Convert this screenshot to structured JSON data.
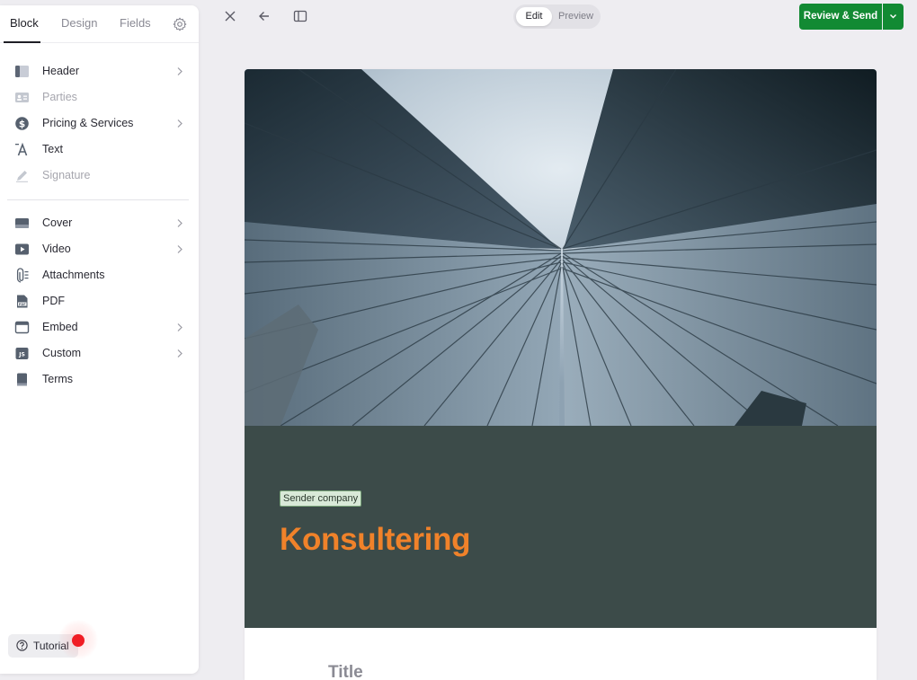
{
  "panel": {
    "tabs": [
      {
        "label": "Block"
      },
      {
        "label": "Design"
      },
      {
        "label": "Fields"
      }
    ],
    "group1": [
      {
        "label": "Header",
        "icon": "header-block-icon",
        "chevron": true,
        "enabled": true
      },
      {
        "label": "Parties",
        "icon": "parties-icon",
        "chevron": false,
        "enabled": false
      },
      {
        "label": "Pricing & Services",
        "icon": "dollar-icon",
        "chevron": true,
        "enabled": true
      },
      {
        "label": "Text",
        "icon": "text-icon",
        "chevron": false,
        "enabled": true
      },
      {
        "label": "Signature",
        "icon": "pen-icon",
        "chevron": false,
        "enabled": false
      }
    ],
    "group2": [
      {
        "label": "Cover",
        "icon": "cover-icon",
        "chevron": true,
        "enabled": true
      },
      {
        "label": "Video",
        "icon": "video-icon",
        "chevron": true,
        "enabled": true
      },
      {
        "label": "Attachments",
        "icon": "paperclip-icon",
        "chevron": false,
        "enabled": true
      },
      {
        "label": "PDF",
        "icon": "pdf-icon",
        "chevron": false,
        "enabled": true
      },
      {
        "label": "Embed",
        "icon": "embed-icon",
        "chevron": true,
        "enabled": true
      },
      {
        "label": "Custom",
        "icon": "js-icon",
        "chevron": true,
        "enabled": true
      },
      {
        "label": "Terms",
        "icon": "book-icon",
        "chevron": false,
        "enabled": true
      }
    ],
    "tutorial_label": "Tutorial"
  },
  "toolbar": {
    "mode_active": "Edit",
    "mode_inactive": "Preview",
    "send_label": "Review & Send"
  },
  "document": {
    "company_tag": "Sender company",
    "heading": "Konsultering",
    "title_placeholder": "Title"
  },
  "colors": {
    "accent_green": "#128a33",
    "cover_band": "#3c4b49",
    "heading_orange": "#f0822a",
    "record_red": "#f01d24"
  }
}
